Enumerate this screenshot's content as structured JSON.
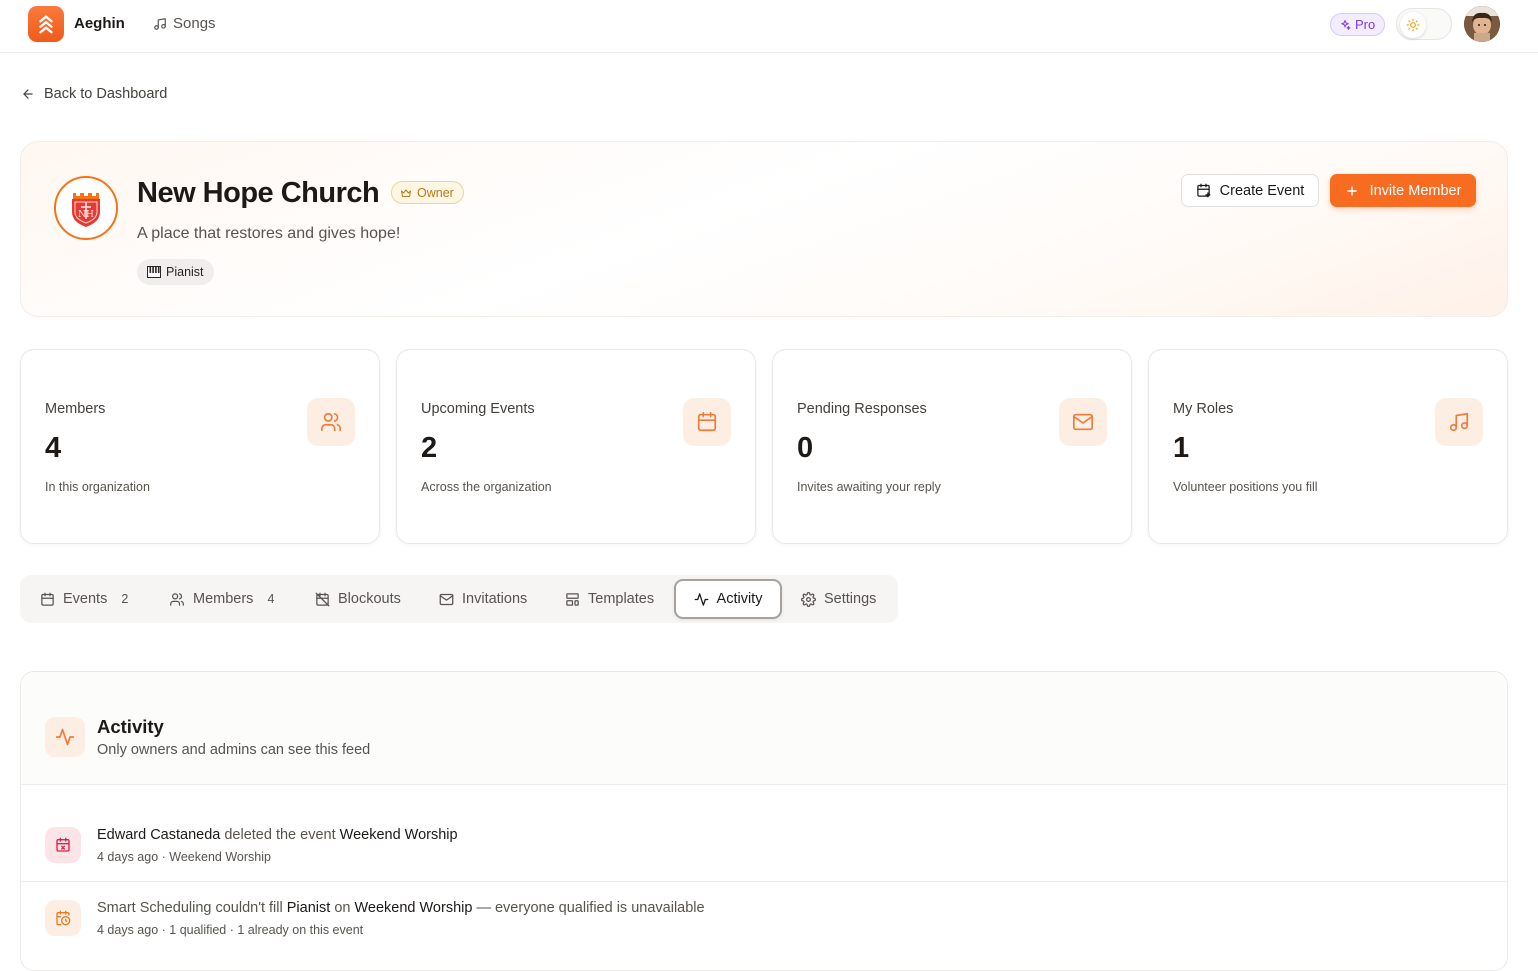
{
  "topbar": {
    "brand": "Aeghin",
    "nav_songs": "Songs",
    "pro_badge": "Pro"
  },
  "back_link": "Back to Dashboard",
  "org": {
    "name": "New Hope Church",
    "owner_badge": "Owner",
    "description": "A place that restores and gives hope!",
    "role_chip": "Pianist",
    "create_event": "Create Event",
    "invite_member": "Invite Member",
    "brand_color": "#f86c22"
  },
  "stats": [
    {
      "label": "Members",
      "value": "4",
      "sub": "In this organization",
      "icon": "users-icon"
    },
    {
      "label": "Upcoming Events",
      "value": "2",
      "sub": "Across the organization",
      "icon": "calendar-icon"
    },
    {
      "label": "Pending Responses",
      "value": "0",
      "sub": "Invites awaiting your reply",
      "icon": "mail-icon"
    },
    {
      "label": "My Roles",
      "value": "1",
      "sub": "Volunteer positions you fill",
      "icon": "music-icon"
    }
  ],
  "tabs": [
    {
      "label": "Events",
      "count": "2"
    },
    {
      "label": "Members",
      "count": "4"
    },
    {
      "label": "Blockouts"
    },
    {
      "label": "Invitations"
    },
    {
      "label": "Templates"
    },
    {
      "label": "Activity",
      "active": true
    },
    {
      "label": "Settings"
    }
  ],
  "activity": {
    "title": "Activity",
    "subtitle": "Only owners and admins can see this feed",
    "items": [
      {
        "actor": "Edward Castaneda",
        "verb": " deleted the event ",
        "target": "Weekend Worship",
        "meta": "4 days ago · Weekend Worship"
      },
      {
        "prefix": "Smart Scheduling couldn't fill ",
        "role": "Pianist",
        "mid": " on ",
        "target": "Weekend Worship",
        "suffix": " — everyone qualified is unavailable",
        "meta": "4 days ago · 1 qualified · 1 already on this event"
      }
    ]
  }
}
